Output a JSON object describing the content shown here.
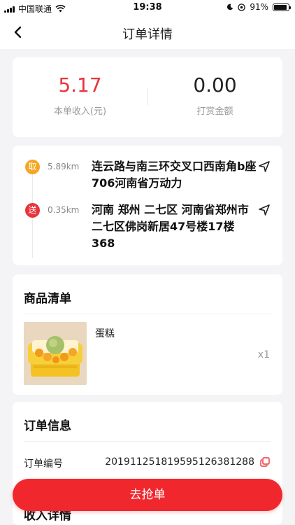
{
  "status_bar": {
    "carrier": "中国联通",
    "time": "19:38",
    "battery": "91%",
    "battery_level": 0.91
  },
  "nav": {
    "title": "订单详情",
    "back_icon": "chevron-left-icon"
  },
  "income": {
    "order_income_value": "5.17",
    "order_income_label": "本单收入(元)",
    "tip_value": "0.00",
    "tip_label": "打赏金额"
  },
  "route": {
    "pickup": {
      "badge": "取",
      "distance": "5.89km",
      "address": "连云路与南三环交叉口西南角b座706河南省万动力"
    },
    "dropoff": {
      "badge": "送",
      "distance": "0.35km",
      "address": "河南 郑州 二七区 河南省郑州市二七区佛岗新居47号楼17楼368"
    }
  },
  "goods": {
    "title": "商品清单",
    "items": [
      {
        "name": "蛋糕",
        "quantity": "x1"
      }
    ]
  },
  "order_info": {
    "title": "订单信息",
    "number_label": "订单编号",
    "number_value": "201911251819595126381288"
  },
  "income_detail": {
    "title": "收入详情"
  },
  "actions": {
    "grab_label": "去抢单"
  },
  "colors": {
    "accent_red": "#e8343a",
    "pickup_orange": "#f5a623",
    "button_red": "#f0282e"
  }
}
